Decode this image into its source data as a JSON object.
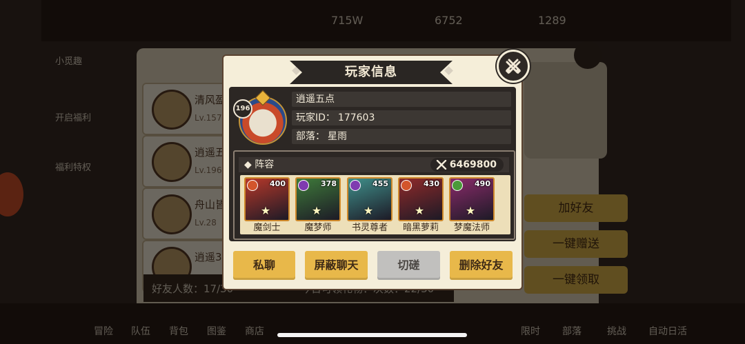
{
  "background": {
    "resources": [
      "715W",
      "6752",
      "1289"
    ],
    "sidebar": [
      "小觅趣",
      "开启福利",
      "福利特权"
    ],
    "friends": [
      {
        "name": "清风盈",
        "level": "Lv.157"
      },
      {
        "name": "逍遥五",
        "level": "Lv.196"
      },
      {
        "name": "舟山皆",
        "level": "Lv.28"
      },
      {
        "name": "逍遥3",
        "level": ""
      }
    ],
    "side_buttons": [
      "加好友",
      "一键赠送",
      "一键领取"
    ],
    "footer": {
      "friend_count": "好友人数：17/30",
      "gift_count": "今日可领礼物：次数：22/30"
    },
    "bottom_nav": [
      "冒险",
      "队伍",
      "背包",
      "图鉴",
      "商店",
      "限时",
      "部落",
      "挑战",
      "自动日活"
    ]
  },
  "modal": {
    "title": "玩家信息",
    "player": {
      "level": "196",
      "name": "逍遥五点",
      "id_label": "玩家ID：",
      "id_value": "177603",
      "tribe_label": "部落：",
      "tribe_value": "星雨"
    },
    "lineup": {
      "title": "阵容",
      "power": "6469800",
      "heroes": [
        {
          "name": "魔剑士",
          "level": "400",
          "element_color": "#d3552c",
          "bg": "#b6382a",
          "star": "★"
        },
        {
          "name": "魔梦师",
          "level": "378",
          "element_color": "#7f3bb0",
          "bg": "#3e7a3a",
          "star": "★"
        },
        {
          "name": "书灵尊者",
          "level": "455",
          "element_color": "#7f3bb0",
          "bg": "#3f8f8a",
          "star": "★"
        },
        {
          "name": "暗黑萝莉",
          "level": "430",
          "element_color": "#d3552c",
          "bg": "#8f2a2a",
          "star": "★"
        },
        {
          "name": "梦魔法师",
          "level": "490",
          "element_color": "#4a9a3a",
          "bg": "#8a2b6a",
          "star": "★"
        }
      ]
    },
    "buttons": {
      "private_chat": "私聊",
      "block_chat": "屏蔽聊天",
      "duel": "切磋",
      "delete_friend": "删除好友"
    }
  }
}
